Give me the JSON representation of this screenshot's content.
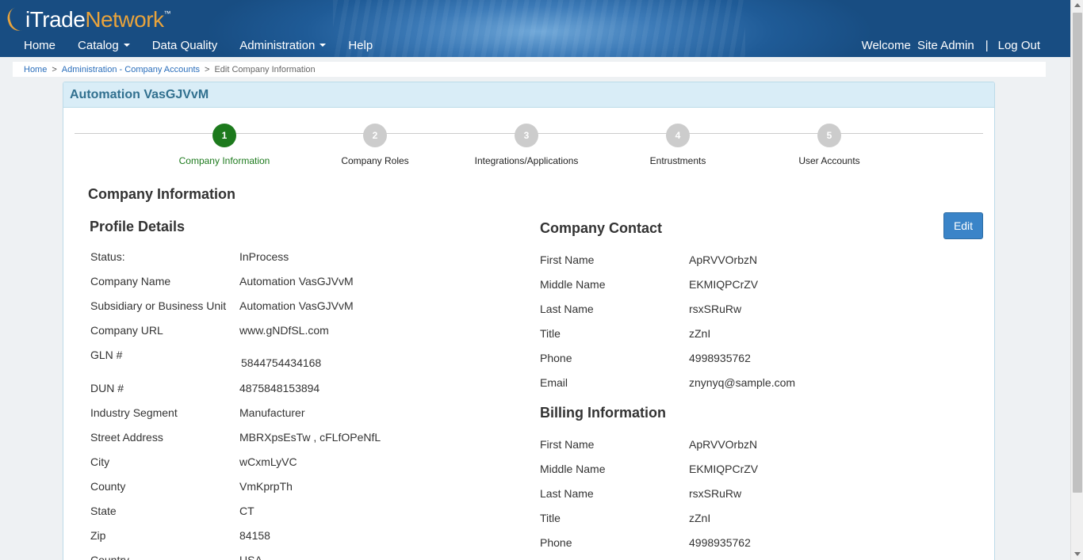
{
  "header": {
    "logo_main": "iTrade",
    "logo_accent": "Network",
    "logo_tm": "™",
    "nav": [
      {
        "label": "Home"
      },
      {
        "label": "Catalog"
      },
      {
        "label": "Data Quality"
      },
      {
        "label": "Administration"
      },
      {
        "label": "Help"
      }
    ],
    "welcome": "Welcome",
    "user_name": "Site Admin",
    "separator": "|",
    "logout": "Log Out"
  },
  "breadcrumb": {
    "home": "Home",
    "sep": ">",
    "parent": "Administration - Company Accounts",
    "current": "Edit Company Information"
  },
  "panel": {
    "title": "Automation VasGJVvM"
  },
  "steps": [
    {
      "num": "1",
      "label": "Company Information",
      "active": true
    },
    {
      "num": "2",
      "label": "Company Roles",
      "active": false
    },
    {
      "num": "3",
      "label": "Integrations/Applications",
      "active": false
    },
    {
      "num": "4",
      "label": "Entrustments",
      "active": false
    },
    {
      "num": "5",
      "label": "User Accounts",
      "active": false
    }
  ],
  "section_title": "Company Information",
  "profile": {
    "title": "Profile Details",
    "rows": [
      {
        "k": "Status:",
        "v": "InProcess"
      },
      {
        "k": "Company Name",
        "v": "Automation VasGJVvM"
      },
      {
        "k": "Subsidiary or Business Unit",
        "v": "Automation VasGJVvM"
      },
      {
        "k": "Company URL",
        "v": "www.gNDfSL.com"
      },
      {
        "k": "GLN #",
        "v": "5844754434168"
      },
      {
        "k": "DUN #",
        "v": "4875848153894"
      },
      {
        "k": "Industry Segment",
        "v": "Manufacturer"
      },
      {
        "k": "Street Address",
        "v": "MBRXpsEsTw , cFLfOPeNfL"
      },
      {
        "k": "City",
        "v": "wCxmLyVC"
      },
      {
        "k": "County",
        "v": "VmKprpTh"
      },
      {
        "k": "State",
        "v": "CT"
      },
      {
        "k": "Zip",
        "v": "84158"
      },
      {
        "k": "Country",
        "v": "USA"
      }
    ]
  },
  "contact": {
    "title": "Company Contact",
    "edit_label": "Edit",
    "rows": [
      {
        "k": "First Name",
        "v": "ApRVVOrbzN"
      },
      {
        "k": "Middle Name",
        "v": "EKMIQPCrZV"
      },
      {
        "k": "Last Name",
        "v": "rsxSRuRw"
      },
      {
        "k": "Title",
        "v": "zZnI"
      },
      {
        "k": "Phone",
        "v": "4998935762"
      },
      {
        "k": "Email",
        "v": "znynyq@sample.com"
      }
    ]
  },
  "billing": {
    "title": "Billing Information",
    "rows": [
      {
        "k": "First Name",
        "v": "ApRVVOrbzN"
      },
      {
        "k": "Middle Name",
        "v": "EKMIQPCrZV"
      },
      {
        "k": "Last Name",
        "v": "rsxSRuRw"
      },
      {
        "k": "Title",
        "v": "zZnI"
      },
      {
        "k": "Phone",
        "v": "4998935762"
      }
    ]
  }
}
